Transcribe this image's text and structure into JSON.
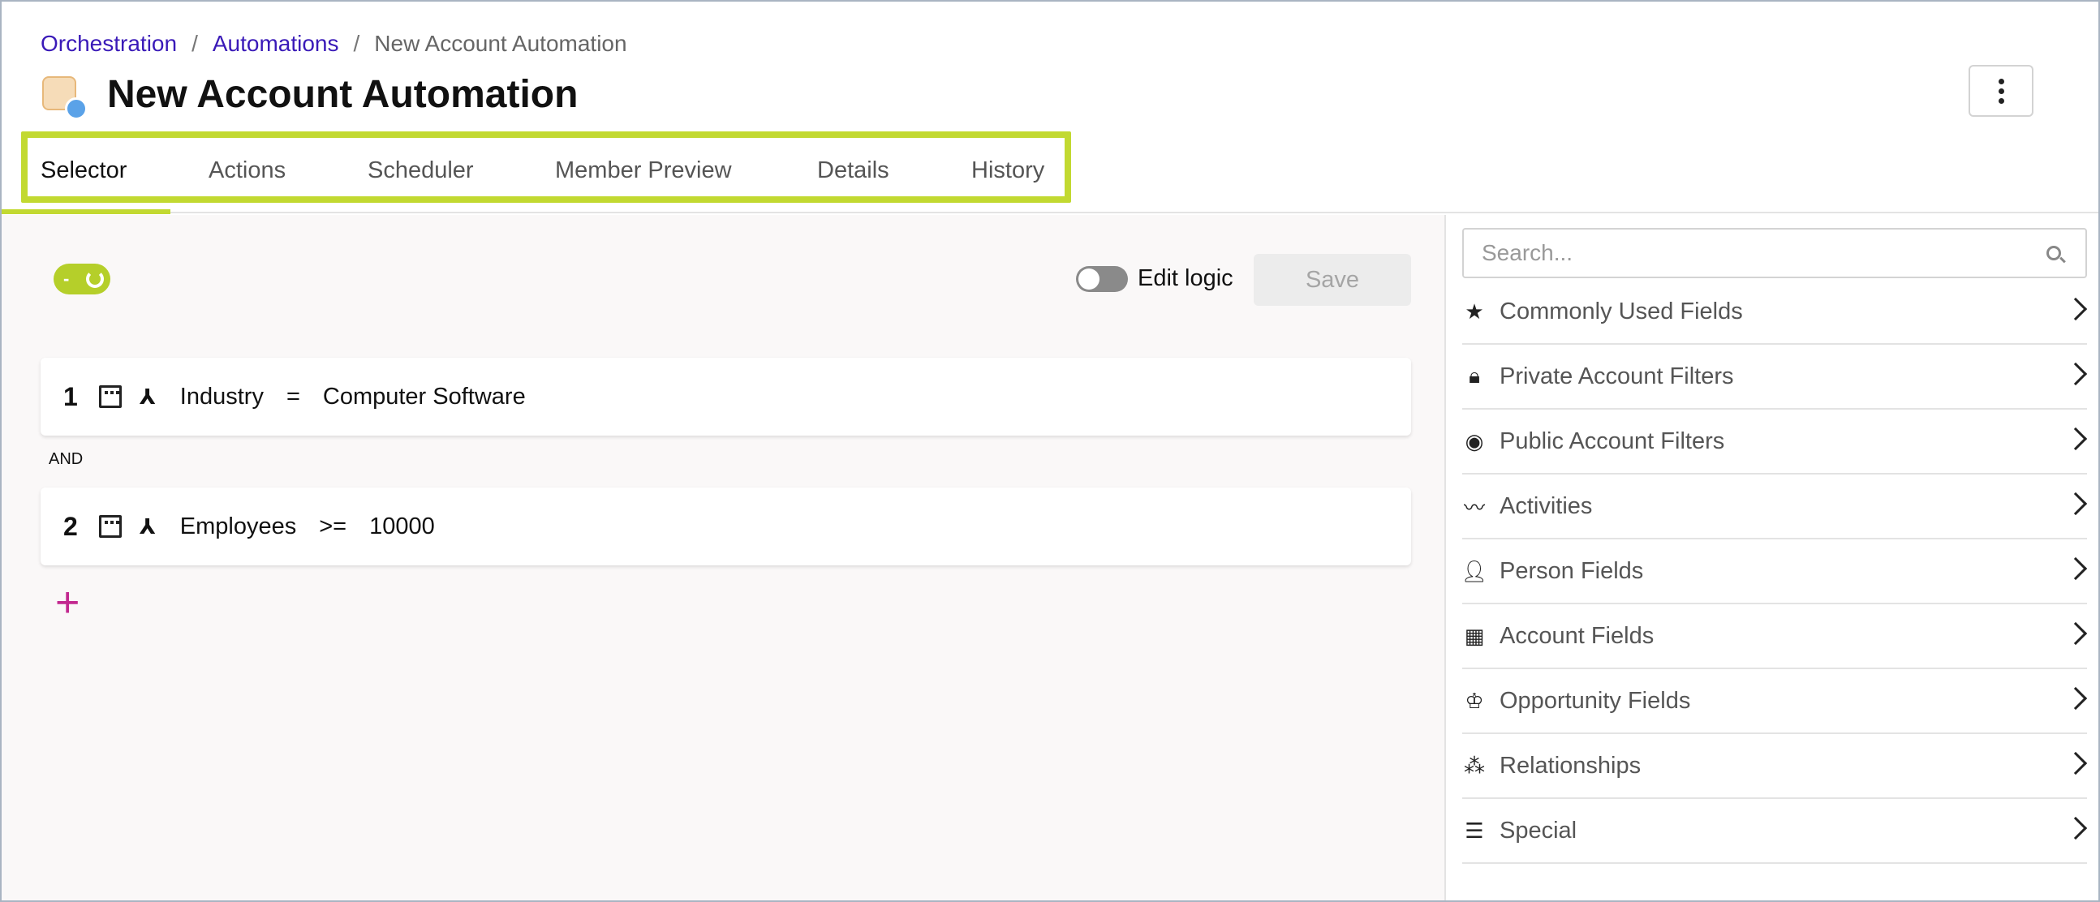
{
  "breadcrumb": {
    "items": [
      "Orchestration",
      "Automations"
    ],
    "separator": "/",
    "current": "New Account Automation"
  },
  "page": {
    "title": "New Account Automation",
    "icon": "automation-icon"
  },
  "tabs": [
    {
      "label": "Selector",
      "active": true
    },
    {
      "label": "Actions",
      "active": false
    },
    {
      "label": "Scheduler",
      "active": false
    },
    {
      "label": "Member Preview",
      "active": false
    },
    {
      "label": "Details",
      "active": false
    },
    {
      "label": "History",
      "active": false
    }
  ],
  "toolbar": {
    "pill_symbol": "-",
    "edit_logic_label": "Edit logic",
    "save_label": "Save"
  },
  "rules": [
    {
      "number": "1",
      "field": "Industry",
      "operator": "=",
      "value": "Computer Software"
    },
    {
      "number": "2",
      "field": "Employees",
      "operator": ">=",
      "value": "10000"
    }
  ],
  "conjunction": "AND",
  "add_symbol": "+",
  "sidebar": {
    "search_placeholder": "Search...",
    "categories": [
      {
        "label": "Commonly Used Fields",
        "icon": "star-icon"
      },
      {
        "label": "Private Account Filters",
        "icon": "lock-icon"
      },
      {
        "label": "Public Account Filters",
        "icon": "eye-icon"
      },
      {
        "label": "Activities",
        "icon": "pulse-icon"
      },
      {
        "label": "Person Fields",
        "icon": "person-icon"
      },
      {
        "label": "Account Fields",
        "icon": "building-icon"
      },
      {
        "label": "Opportunity Fields",
        "icon": "crown-icon"
      },
      {
        "label": "Relationships",
        "icon": "relationships-icon"
      },
      {
        "label": "Special",
        "icon": "list-icon"
      }
    ]
  },
  "colors": {
    "accent": "#c2d931",
    "link": "#3a1ab8",
    "add": "#c2288f"
  }
}
